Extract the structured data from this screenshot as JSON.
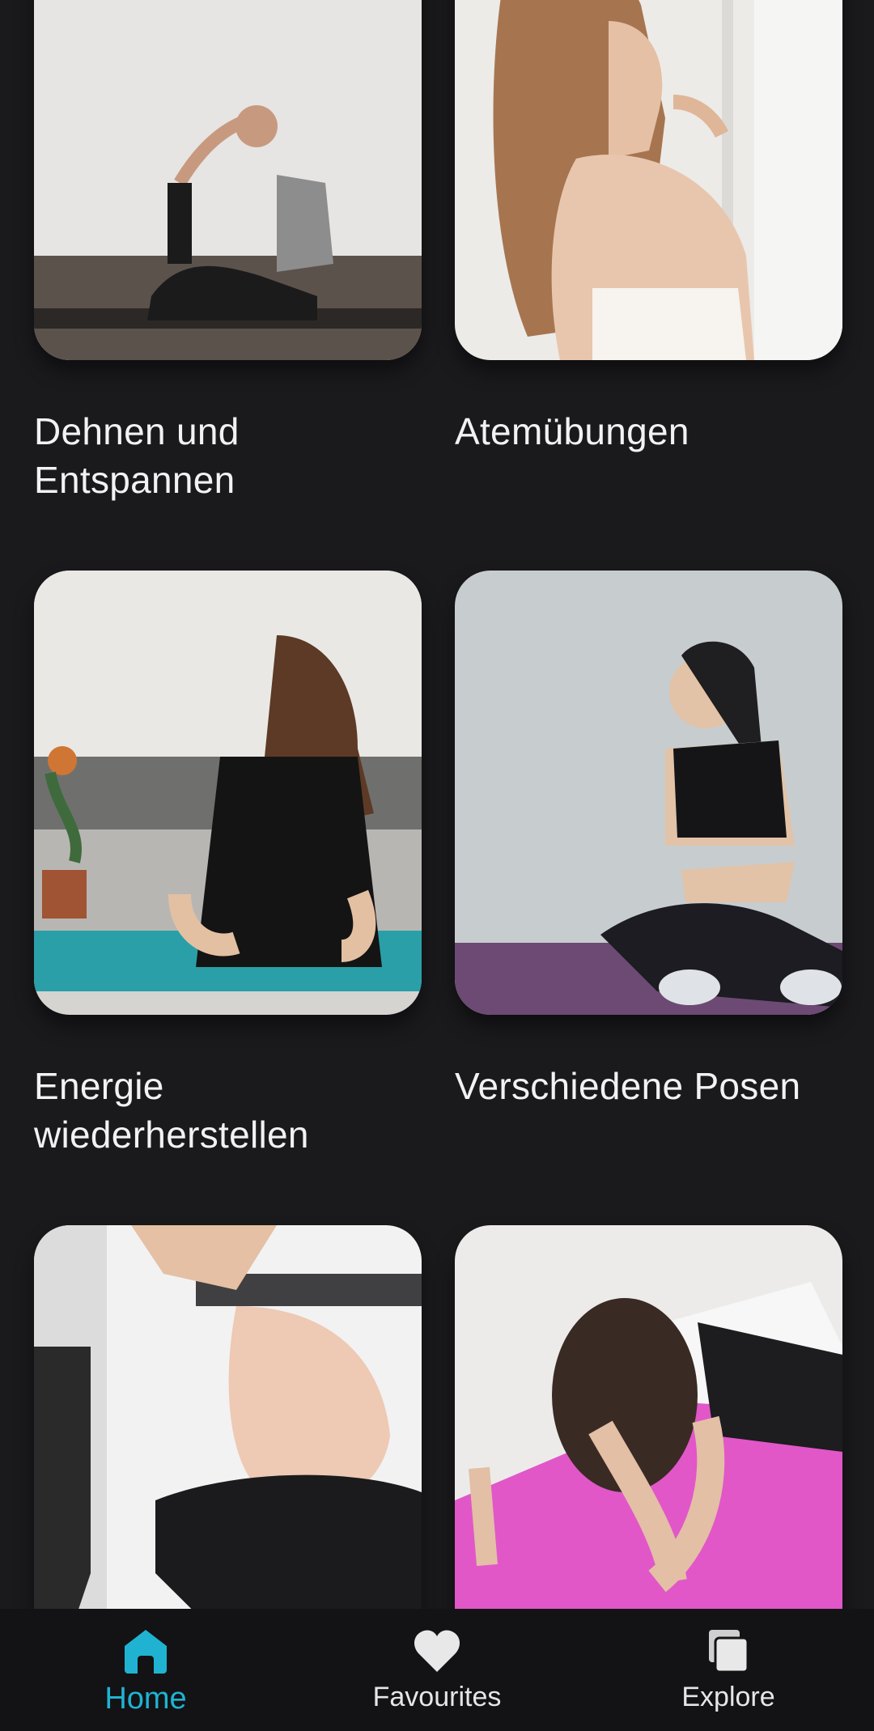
{
  "cards": [
    {
      "title": "Dehnen und Entspannen"
    },
    {
      "title": "Atemübungen"
    },
    {
      "title": "Energie wiederherstellen"
    },
    {
      "title": "Verschiedene Posen"
    },
    {
      "title": ""
    },
    {
      "title": ""
    }
  ],
  "nav": {
    "items": [
      {
        "label": "Home",
        "icon": "home-icon",
        "active": true
      },
      {
        "label": "Favourites",
        "icon": "heart-icon",
        "active": false
      },
      {
        "label": "Explore",
        "icon": "stacked-pages-icon",
        "active": false
      }
    ]
  },
  "colors": {
    "background": "#1a191c",
    "navbar": "#131215",
    "accent": "#1fb3d1",
    "text": "#f2f2f2"
  }
}
